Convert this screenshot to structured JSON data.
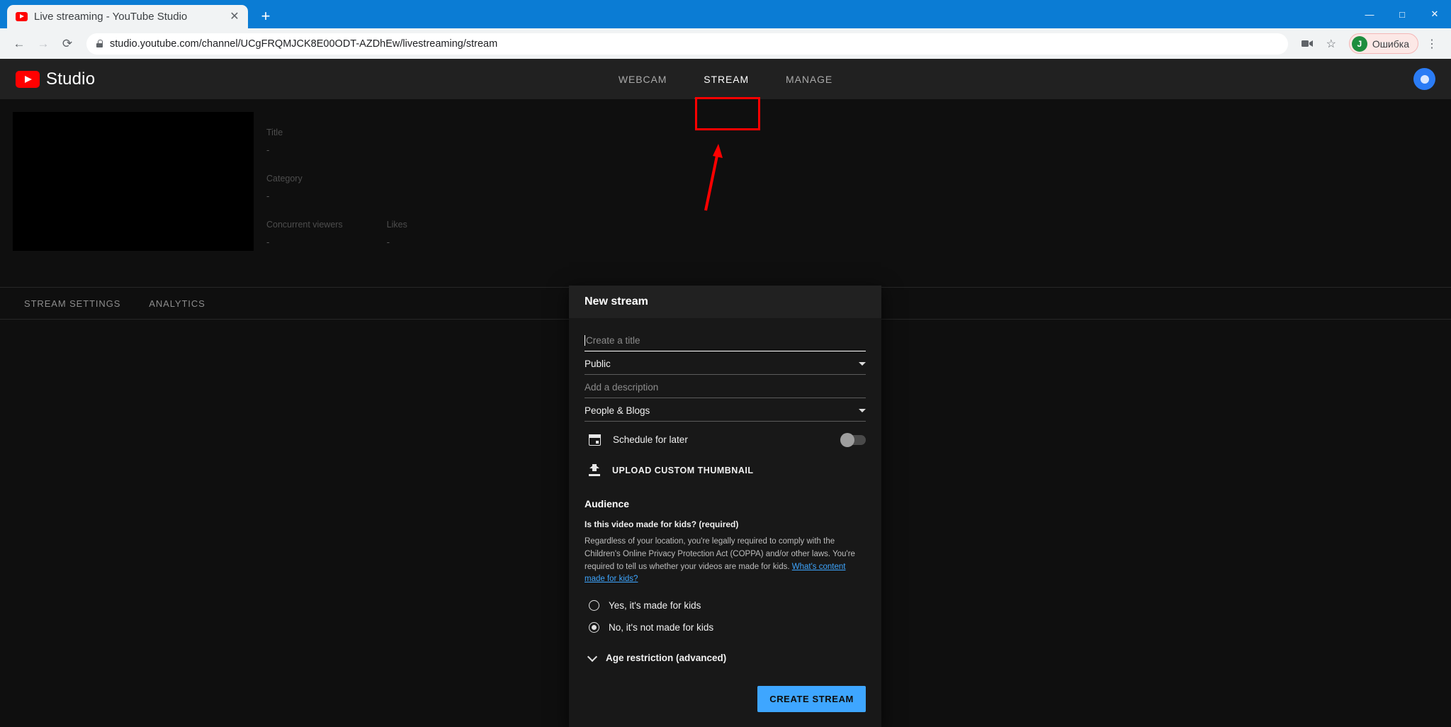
{
  "browser": {
    "tab": {
      "title": "Live streaming - YouTube Studio",
      "close_label": "✕"
    },
    "new_tab_label": "+",
    "window_controls": {
      "minimize": "—",
      "maximize": "□",
      "close": "✕"
    },
    "nav": {
      "back": "←",
      "forward": "→",
      "reload": "⟳"
    },
    "url": "studio.youtube.com/channel/UCgFRQMJCK8E00ODT-AZDhEw/livestreaming/stream",
    "toolbar_icons": {
      "media": "■",
      "bookmark": "☆",
      "menu": "⋮"
    },
    "profile": {
      "initial": "J",
      "label": "Ошибка"
    }
  },
  "studio": {
    "logo_text": "Studio",
    "tabs": [
      {
        "label": "WEBCAM",
        "active": false
      },
      {
        "label": "STREAM",
        "active": true
      },
      {
        "label": "MANAGE",
        "active": false
      }
    ],
    "meta": {
      "title_label": "Title",
      "title_value": "-",
      "category_label": "Category",
      "category_value": "-",
      "viewers_label": "Concurrent viewers",
      "viewers_value": "-",
      "likes_label": "Likes",
      "likes_value": "-"
    },
    "sub_tabs": [
      {
        "label": "STREAM SETTINGS"
      },
      {
        "label": "ANALYTICS"
      }
    ]
  },
  "dialog": {
    "header": "New stream",
    "title_placeholder": "Create a title",
    "title_value": "",
    "visibility_value": "Public",
    "description_placeholder": "Add a description",
    "description_value": "",
    "category_value": "People & Blogs",
    "schedule_label": "Schedule for later",
    "schedule_on": false,
    "upload_thumbnail_label": "UPLOAD CUSTOM THUMBNAIL",
    "audience_title": "Audience",
    "kids_question": "Is this video made for kids? (required)",
    "kids_body": "Regardless of your location, you're legally required to comply with the Children's Online Privacy Protection Act (COPPA) and/or other laws. You're required to tell us whether your videos are made for kids. ",
    "kids_link": "What's content made for kids?",
    "radio_yes": "Yes, it's made for kids",
    "radio_no": "No, it's not made for kids",
    "selected_radio": "no",
    "age_restriction_label": "Age restriction (advanced)",
    "create_button": "CREATE STREAM"
  },
  "colors": {
    "accent_blue": "#3ea6ff",
    "annotation_red": "#ff0000",
    "browser_blue": "#0b7cd4"
  }
}
